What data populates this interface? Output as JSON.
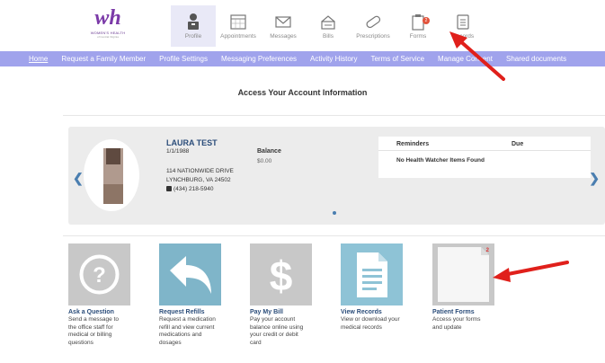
{
  "header": {
    "logo": {
      "mark": "wh",
      "text": "WOMEN'S HEALTH",
      "sub": "of Central Virginia"
    },
    "nav": [
      {
        "label": "Profile",
        "icon": "person-icon",
        "active": true
      },
      {
        "label": "Appointments",
        "icon": "calendar-icon",
        "active": false
      },
      {
        "label": "Messages",
        "icon": "envelope-icon",
        "active": false
      },
      {
        "label": "Bills",
        "icon": "bills-icon",
        "active": false
      },
      {
        "label": "Prescriptions",
        "icon": "pill-icon",
        "active": false
      },
      {
        "label": "Forms",
        "icon": "clipboard-icon",
        "active": false,
        "badge": "2"
      },
      {
        "label": "Records",
        "icon": "records-icon",
        "active": false
      }
    ]
  },
  "subnav": {
    "items": [
      {
        "label": "Home",
        "active": true
      },
      {
        "label": "Request a Family Member"
      },
      {
        "label": "Profile Settings"
      },
      {
        "label": "Messaging Preferences"
      },
      {
        "label": "Activity History"
      },
      {
        "label": "Terms of Service"
      },
      {
        "label": "Manage Consent"
      },
      {
        "label": "Shared documents"
      }
    ]
  },
  "page_title": "Access Your Account Information",
  "account": {
    "name": "LAURA TEST",
    "dob": "1/1/1988",
    "address_line1": "114 NATIONWIDE DRIVE",
    "address_line2": "LYNCHBURG, VA 24502",
    "phone": "(434) 218-5940",
    "balance_label": "Balance",
    "balance_value": "$0.00",
    "reminders": {
      "col1": "Reminders",
      "col2": "Due",
      "empty": "No Health Watcher Items Found"
    }
  },
  "tiles": [
    {
      "title": "Ask a Question",
      "desc": "Send a message to the office staff for medical or billing questions",
      "icon": "question-icon"
    },
    {
      "title": "Request Refills",
      "desc": "Request a medication refill and view current medications and dosages",
      "icon": "reply-arrow-icon"
    },
    {
      "title": "Pay My Bill",
      "desc": "Pay your account balance online using your credit or debit card",
      "icon": "dollar-icon"
    },
    {
      "title": "View Records",
      "desc": "View or download your medical records",
      "icon": "document-icon"
    },
    {
      "title": "Patient Forms",
      "desc": "Access your forms and update",
      "icon": "blank-page-icon",
      "badge": "2"
    }
  ],
  "colors": {
    "subnav_bg": "#a0a3ec",
    "tile_gray": "#c8c8c8",
    "tile_blue": "#7fb5c9",
    "tile_blue2": "#8ec3d6",
    "link_blue": "#2b4d7a",
    "annotation_red": "#e0201b"
  }
}
